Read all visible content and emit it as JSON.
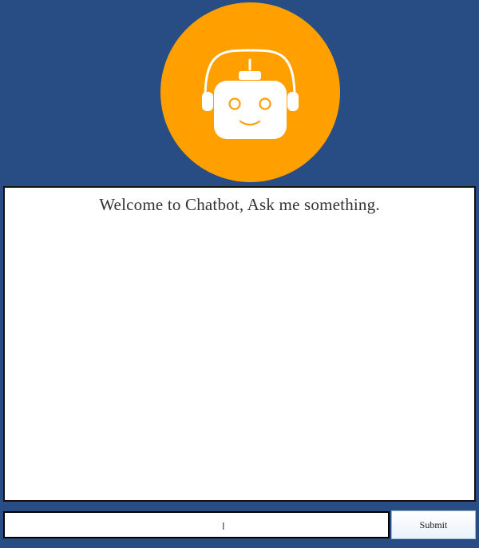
{
  "header": {
    "avatar_icon": "robot-headset-icon",
    "colors": {
      "background": "#284d84",
      "avatar_circle": "#ff9f00",
      "robot": "#ffffff"
    }
  },
  "chat": {
    "welcome_message": "Welcome to Chatbot, Ask me something."
  },
  "composer": {
    "input_value": "",
    "input_placeholder": "",
    "submit_label": "Submit"
  }
}
